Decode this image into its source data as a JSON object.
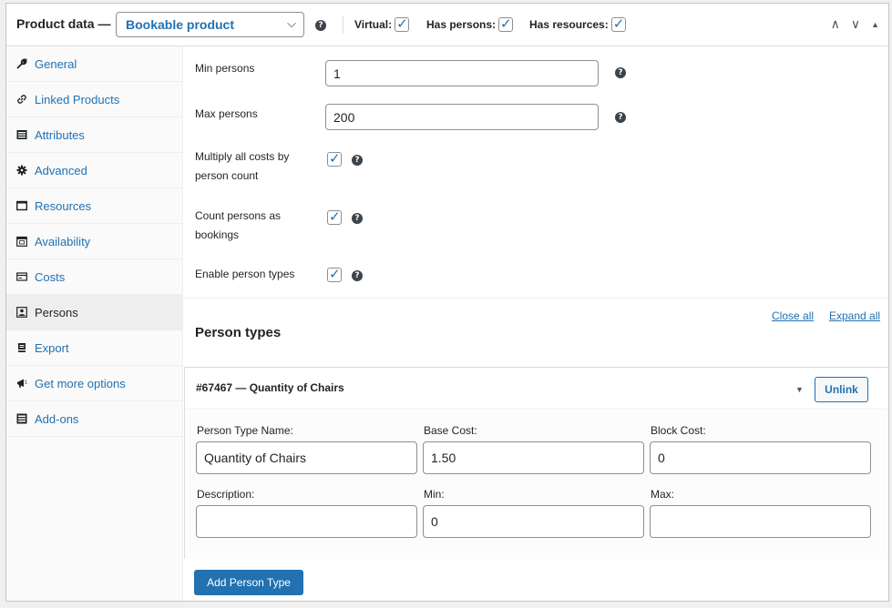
{
  "header": {
    "title": "Product data —",
    "product_type": "Bookable product",
    "chevron": "⌵",
    "help": "?",
    "virtual_label": "Virtual:",
    "has_persons_label": "Has persons:",
    "has_resources_label": "Has resources:",
    "check": "✓",
    "arrow_up": "∧",
    "arrow_down": "∨",
    "arrow_collapse": "▲"
  },
  "sidebar": {
    "items": [
      {
        "label": "General",
        "icon": "wrench-icon"
      },
      {
        "label": "Linked Products",
        "icon": "link-icon"
      },
      {
        "label": "Attributes",
        "icon": "list-icon"
      },
      {
        "label": "Advanced",
        "icon": "gear-icon"
      },
      {
        "label": "Resources",
        "icon": "window-icon"
      },
      {
        "label": "Availability",
        "icon": "calendar-icon"
      },
      {
        "label": "Costs",
        "icon": "money-icon"
      },
      {
        "label": "Persons",
        "icon": "person-icon"
      },
      {
        "label": "Export",
        "icon": "export-icon"
      },
      {
        "label": "Get more options",
        "icon": "megaphone-icon"
      },
      {
        "label": "Add-ons",
        "icon": "grid-icon"
      }
    ],
    "active": "Persons"
  },
  "main": {
    "min_persons_label": "Min persons",
    "min_persons_value": "1",
    "max_persons_label": "Max persons",
    "max_persons_value": "200",
    "multiply_label_1": "Multiply all costs by",
    "multiply_label_2": "person count",
    "count_label_1": "Count persons as",
    "count_label_2": "bookings",
    "enable_types_label": "Enable person types",
    "section_title": "Person types",
    "close_all": "Close all",
    "expand_all": "Expand all",
    "person_type": {
      "title": "#67467 — Quantity of Chairs",
      "triangle": "▼",
      "unlink_label": "Unlink",
      "name_label": "Person Type Name:",
      "name_value": "Quantity of Chairs",
      "base_cost_label": "Base Cost:",
      "base_cost_value": "1.50",
      "block_cost_label": "Block Cost:",
      "block_cost_value": "0",
      "description_label": "Description:",
      "description_value": "",
      "min_label": "Min:",
      "min_value": "0",
      "max_label": "Max:",
      "max_value": ""
    },
    "add_button": "Add Person Type"
  },
  "colors": {
    "link": "#2271b1",
    "primary_button": "#2271b1",
    "active_tab_bg": "#eeeeee"
  }
}
